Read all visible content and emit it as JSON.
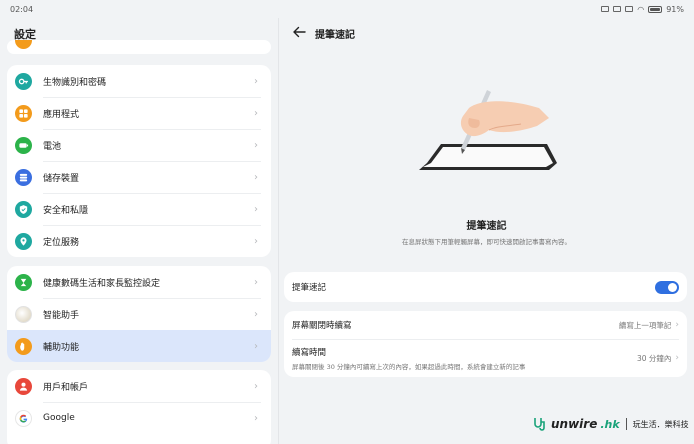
{
  "status": {
    "time": "02:04",
    "battery": "91%"
  },
  "left": {
    "title": "設定",
    "groups": [
      {
        "items": [
          {
            "label": "生物識別和密碼",
            "color": "#1fa8a0",
            "icon": "key-icon"
          },
          {
            "label": "應用程式",
            "color": "#f39b1c",
            "icon": "apps-icon"
          },
          {
            "label": "電池",
            "color": "#2cb34a",
            "icon": "battery-icon"
          },
          {
            "label": "儲存裝置",
            "color": "#3b6fe0",
            "icon": "storage-icon"
          },
          {
            "label": "安全和私隱",
            "color": "#1fa8a0",
            "icon": "shield-icon"
          },
          {
            "label": "定位服務",
            "color": "#1fa8a0",
            "icon": "location-icon"
          }
        ]
      },
      {
        "items": [
          {
            "label": "健康數碼生活和家長監控設定",
            "color": "#2cb34a",
            "icon": "hourglass-icon"
          },
          {
            "label": "智能助手",
            "color": "#e8e8e8",
            "icon": "assistant-icon"
          },
          {
            "label": "輔助功能",
            "color": "#f39b1c",
            "icon": "hand-icon",
            "selected": true
          }
        ]
      },
      {
        "items": [
          {
            "label": "用戶和帳戶",
            "color": "#e8483b",
            "icon": "user-icon"
          },
          {
            "label": "Google",
            "color": "#ffffff",
            "icon": "google-icon"
          }
        ]
      }
    ]
  },
  "right": {
    "title": "提筆速記",
    "feature_title": "提筆速記",
    "feature_desc": "在息屏狀態下用筆輕觸屏幕，即可快速開啟記事書寫內容。",
    "toggle_label": "提筆速記",
    "toggle_on": true,
    "screen_off_label": "屏幕關閉時續寫",
    "screen_off_value": "續寫上一項筆記",
    "resume_label": "續寫時間",
    "resume_desc": "屏幕關閉後 30 分鐘內可續寫上次的內容，如果超過此時間，系統會建立新的記事",
    "resume_value": "30 分鐘內"
  },
  "watermark": {
    "brand": "unwire",
    "domain": ".hk",
    "tagline": "玩生活．樂科技"
  }
}
